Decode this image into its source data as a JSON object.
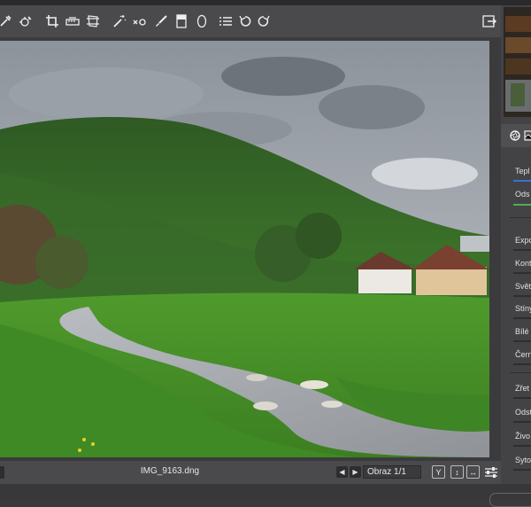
{
  "toolbar": {
    "tools": [
      {
        "icon": "eyedropper-icon"
      },
      {
        "icon": "target-picker-icon"
      },
      {
        "icon": "crop-icon"
      },
      {
        "icon": "straighten-icon"
      },
      {
        "icon": "perspective-icon"
      },
      {
        "icon": "magic-wand-icon"
      },
      {
        "icon": "spot-heal-icon"
      },
      {
        "icon": "brush-icon"
      },
      {
        "icon": "gradient-icon"
      },
      {
        "icon": "ellipse-icon"
      },
      {
        "icon": "list-icon"
      },
      {
        "icon": "undo-icon"
      },
      {
        "icon": "redo-icon"
      },
      {
        "icon": "export-icon"
      }
    ]
  },
  "bottombar": {
    "filename": "IMG_9163.dng",
    "page_value": "Obraz 1/1",
    "y_button": "Y"
  },
  "panel": {
    "labels": [
      "Tepl",
      "Ods",
      "Expo",
      "Kont",
      "Svět",
      "Stíny",
      "Bílé",
      "Čern",
      "Zřet",
      "Odst",
      "Živo",
      "Syto"
    ]
  },
  "colors": {
    "toolbar_bg": "#4a4a4d",
    "panel_bg": "#434346",
    "temp_track": "#3b6fd6",
    "tint_track": "#4caf50"
  }
}
